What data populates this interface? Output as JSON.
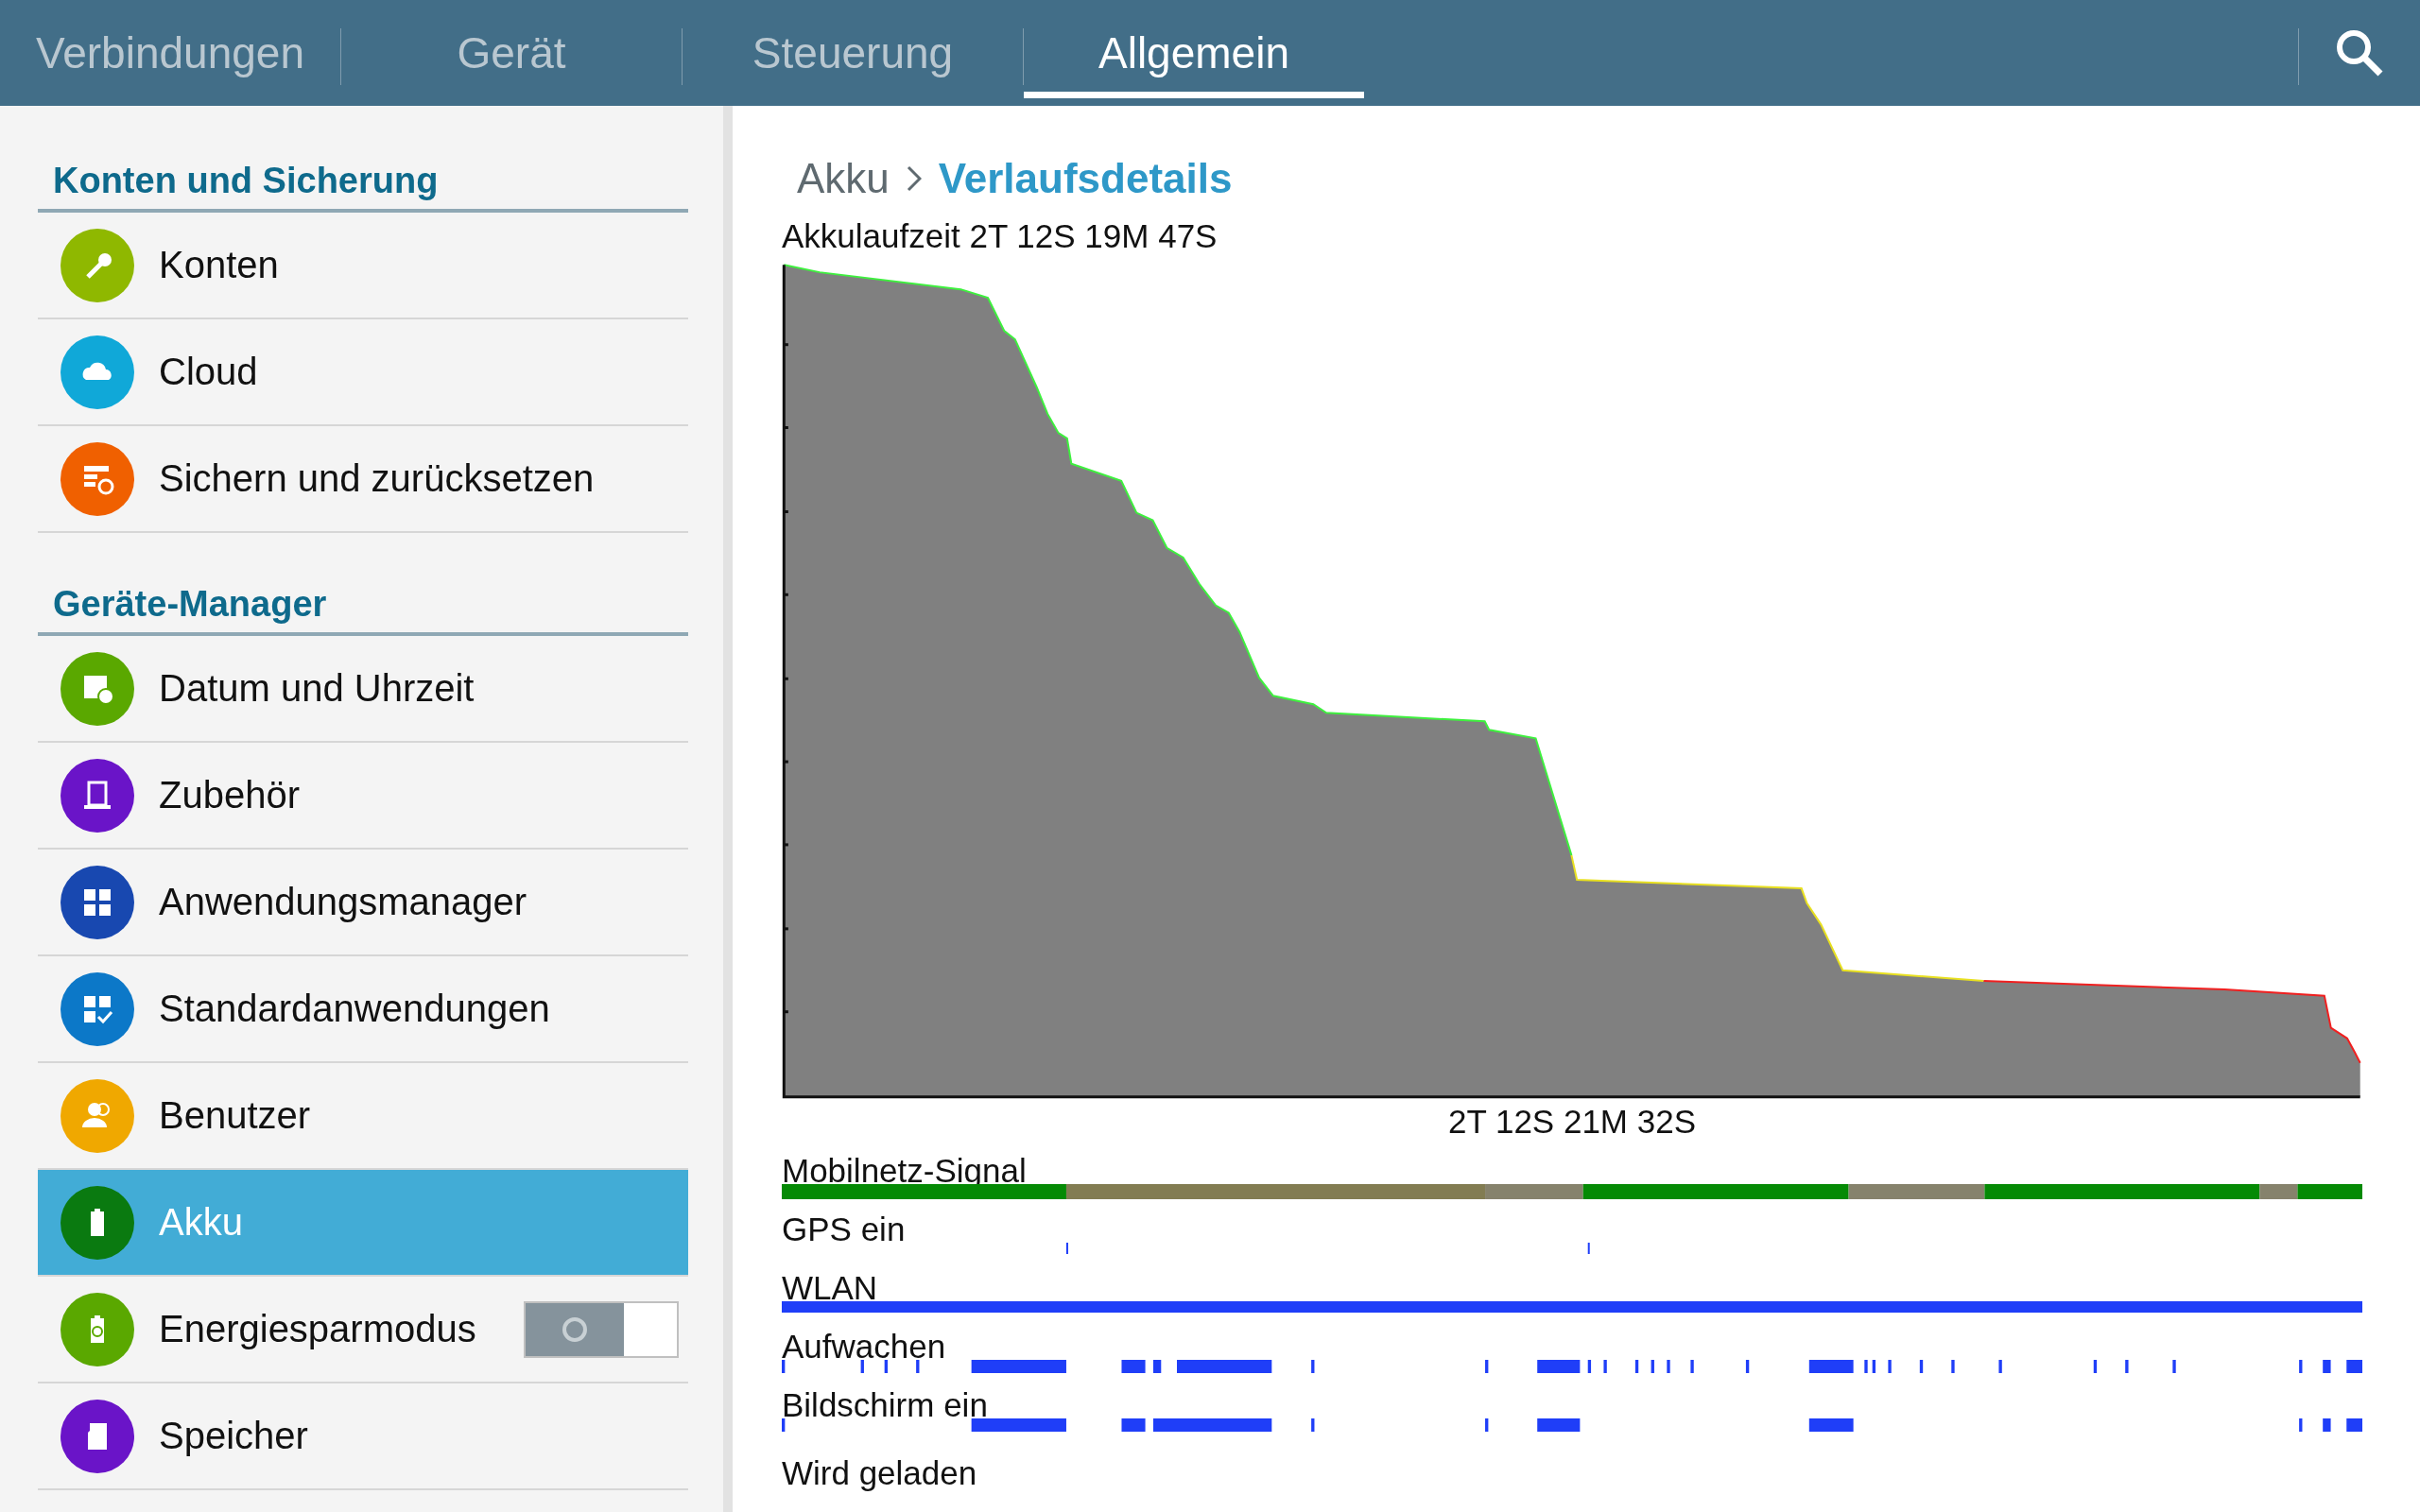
{
  "tabs": [
    {
      "label": "Verbindungen",
      "selected": false
    },
    {
      "label": "Gerät",
      "selected": false
    },
    {
      "label": "Steuerung",
      "selected": false
    },
    {
      "label": "Allgemein",
      "selected": true
    }
  ],
  "sidebar": {
    "sections": [
      {
        "title": "Konten und Sicherung",
        "items": [
          {
            "label": "Konten",
            "kind": "key",
            "color": "#8fb800",
            "selected": false
          },
          {
            "label": "Cloud",
            "kind": "cloud",
            "color": "#10a8d8",
            "selected": false
          },
          {
            "label": "Sichern und zurücksetzen",
            "kind": "backup",
            "color": "#f06000",
            "selected": false
          }
        ]
      },
      {
        "title": "Geräte-Manager",
        "items": [
          {
            "label": "Datum und Uhrzeit",
            "kind": "calendar",
            "color": "#5aa800",
            "selected": false
          },
          {
            "label": "Zubehör",
            "kind": "accessory",
            "color": "#6a14c8",
            "selected": false
          },
          {
            "label": "Anwendungsmanager",
            "kind": "grid",
            "color": "#1848b0",
            "selected": false
          },
          {
            "label": "Standardanwendungen",
            "kind": "gridcheck",
            "color": "#0c78c8",
            "selected": false
          },
          {
            "label": "Benutzer",
            "kind": "users",
            "color": "#f0a800",
            "selected": false
          },
          {
            "label": "Akku",
            "kind": "battery",
            "color": "#0a7a10",
            "selected": true
          },
          {
            "label": "Energiesparmodus",
            "kind": "recycle",
            "color": "#5aa800",
            "selected": false,
            "toggle": {
              "on": false
            }
          },
          {
            "label": "Speicher",
            "kind": "sdcard",
            "color": "#6a14c8",
            "selected": false
          }
        ]
      }
    ]
  },
  "breadcrumb": {
    "parent": "Akku",
    "current": "Verlaufsdetails"
  },
  "battery": {
    "runtime": "Akkulaufzeit 2T 12S 19M 47S",
    "time_label": "2T 12S 21M 32S"
  },
  "tracks": [
    {
      "label": "Mobilnetz-Signal",
      "kind": "signal"
    },
    {
      "label": "GPS ein",
      "kind": "gps"
    },
    {
      "label": "WLAN",
      "kind": "wlan"
    },
    {
      "label": "Aufwachen",
      "kind": "awake"
    },
    {
      "label": "Bildschirm ein",
      "kind": "screen"
    },
    {
      "label": "Wird geladen",
      "kind": "charging"
    }
  ]
}
